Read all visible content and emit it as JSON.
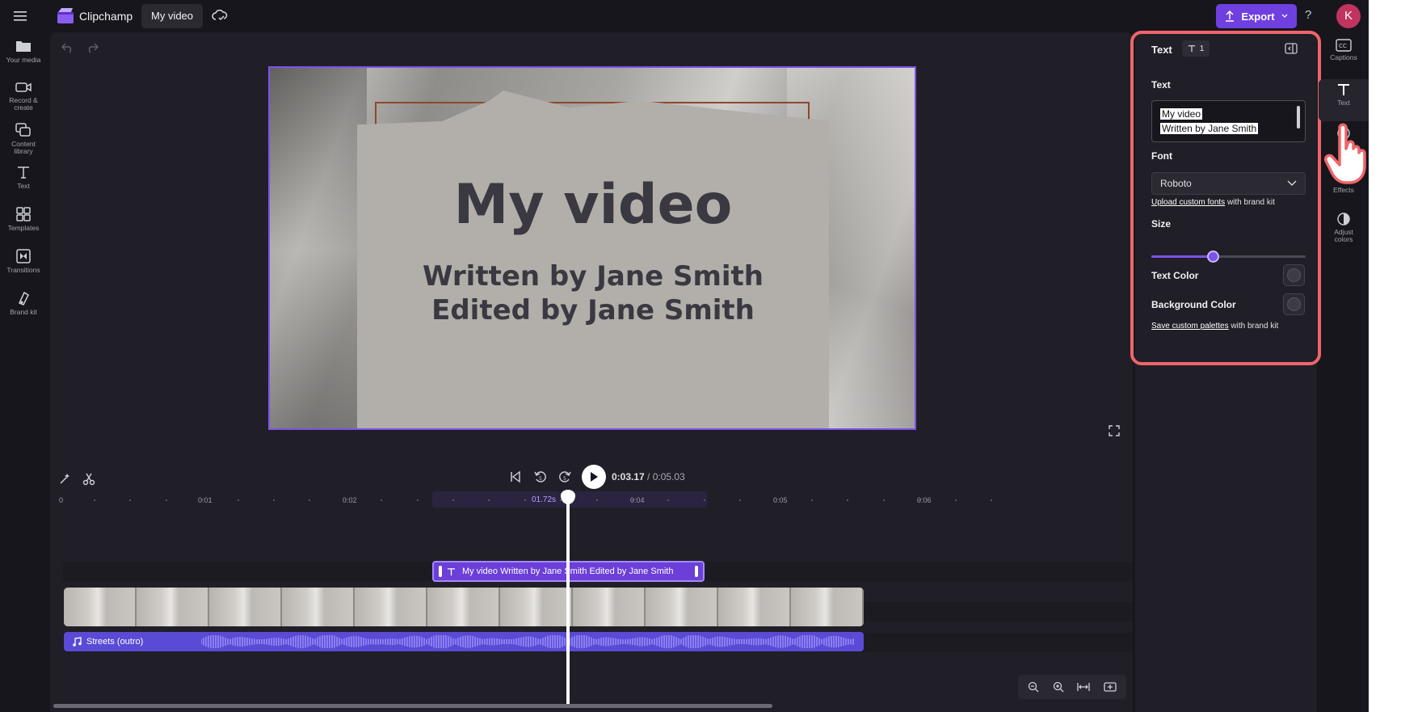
{
  "header": {
    "app_name": "Clipchamp",
    "project_name": "My video",
    "export_label": "Export",
    "help_label": "?",
    "avatar_initial": "K"
  },
  "sidebar": {
    "items": [
      {
        "label": "Your media",
        "icon": "folder-icon"
      },
      {
        "label": "Record & create",
        "icon": "camera-icon"
      },
      {
        "label": "Content library",
        "icon": "library-icon"
      },
      {
        "label": "Text",
        "icon": "text-icon"
      },
      {
        "label": "Templates",
        "icon": "templates-icon"
      },
      {
        "label": "Transitions",
        "icon": "transitions-icon"
      },
      {
        "label": "Brand kit",
        "icon": "brand-kit-icon"
      }
    ]
  },
  "preview": {
    "title": "My video",
    "line1": "Written by Jane Smith",
    "line2": "Edited by Jane Smith"
  },
  "playback": {
    "current_time": "0:03.17",
    "total_time": "/ 0:05.03"
  },
  "timeline": {
    "ruler": [
      "0",
      "0:01",
      "0:02",
      "0:04",
      "0:05",
      "0:06"
    ],
    "playhead_label": "01.72s",
    "text_clip_label": "My video Written by Jane Smith Edited by Jane Smith",
    "audio_clip_label": "Streets (outro)",
    "frame_count": 11
  },
  "properties": {
    "header": "Text",
    "badge_count": "1",
    "text_label": "Text",
    "text_lines": [
      "My video",
      "Written by Jane Smith"
    ],
    "font_label": "Font",
    "font_value": "Roboto",
    "upload_link": "Upload custom fonts",
    "upload_suffix": " with brand kit",
    "size_label": "Size",
    "size_fraction": 0.4,
    "text_color_label": "Text Color",
    "bg_color_label": "Background Color",
    "palette_link": "Save custom palettes",
    "palette_suffix": " with brand kit"
  },
  "rail": {
    "items": [
      {
        "label": "Captions",
        "icon": "captions-icon"
      },
      {
        "label": "Text",
        "icon": "text-icon"
      },
      {
        "label": "",
        "icon": "filters-icon"
      },
      {
        "label": "Effects",
        "icon": "effects-icon"
      },
      {
        "label": "Adjust colors",
        "icon": "adjust-colors-icon"
      }
    ]
  },
  "colors": {
    "accent": "#7c52e8",
    "highlight": "#f0656a",
    "background": "#17161d"
  }
}
